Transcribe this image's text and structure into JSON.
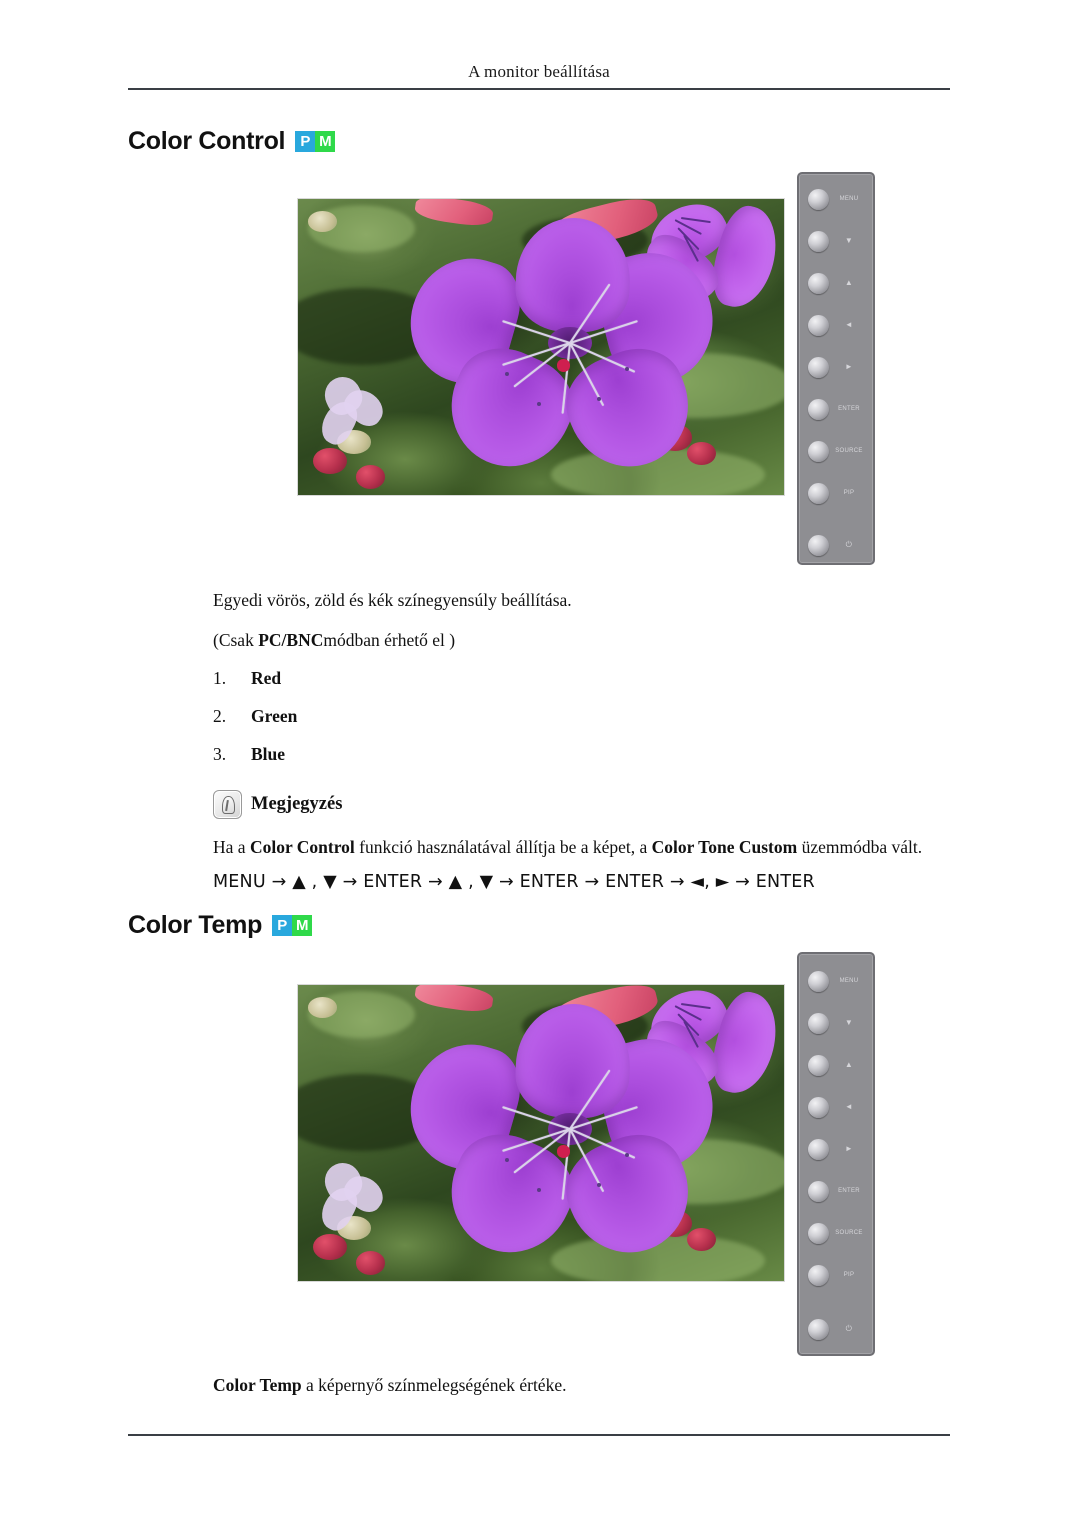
{
  "header": {
    "running_title": "A monitor beállítása"
  },
  "sections": [
    {
      "id": "color-control",
      "title": "Color Control",
      "badges": [
        {
          "label": "P",
          "color": "#29a8dd",
          "name": "pc-mode-badge"
        },
        {
          "label": "M",
          "color": "#2fd94a",
          "name": "mode-badge"
        }
      ],
      "description": "Egyedi vörös, zöld és kék színegyensúly beállítása.",
      "availability_prefix": "(Csak ",
      "availability_bold": "PC/BNC",
      "availability_suffix": "módban érhető el )",
      "items": [
        {
          "index": "1.",
          "label": "Red"
        },
        {
          "index": "2.",
          "label": "Green"
        },
        {
          "index": "3.",
          "label": "Blue"
        }
      ],
      "note": {
        "title": "Megjegyzés",
        "icon": "note-hand-icon",
        "body_part1": "Ha a ",
        "body_bold1": "Color Control",
        "body_part2": " funkció használatával állítja be a képet, a ",
        "body_bold2": "Color Tone Custom",
        "body_part3": " üzemmódba vált.",
        "menu_path": "MENU → ▲ , ▼ → ENTER → ▲ , ▼ → ENTER → ENTER → ◄, ► → ENTER"
      }
    },
    {
      "id": "color-temp",
      "title": "Color Temp",
      "badges": [
        {
          "label": "P",
          "color": "#29a8dd",
          "name": "pc-mode-badge"
        },
        {
          "label": "M",
          "color": "#2fd94a",
          "name": "mode-badge"
        }
      ],
      "caption_bold": "Color Temp",
      "caption_rest": " a képernyő színmelegségének értéke."
    }
  ],
  "monitor_panel": {
    "buttons": [
      {
        "name": "menu-button",
        "label": "MENU",
        "symbol": false
      },
      {
        "name": "down-button",
        "label": "▼",
        "symbol": true
      },
      {
        "name": "up-button",
        "label": "▲",
        "symbol": true
      },
      {
        "name": "left-button",
        "label": "◄",
        "symbol": true
      },
      {
        "name": "right-button",
        "label": "►",
        "symbol": true
      },
      {
        "name": "enter-button",
        "label": "ENTER",
        "symbol": false
      },
      {
        "name": "source-button",
        "label": "SOURCE",
        "symbol": false
      },
      {
        "name": "pip-button",
        "label": "PIP",
        "symbol": false
      },
      {
        "name": "power-button",
        "label": "⏻",
        "symbol": true
      }
    ]
  },
  "figure": {
    "alt": "Lila Tibouchina virág zöld levelekkel — monitor képernyő példakép"
  }
}
